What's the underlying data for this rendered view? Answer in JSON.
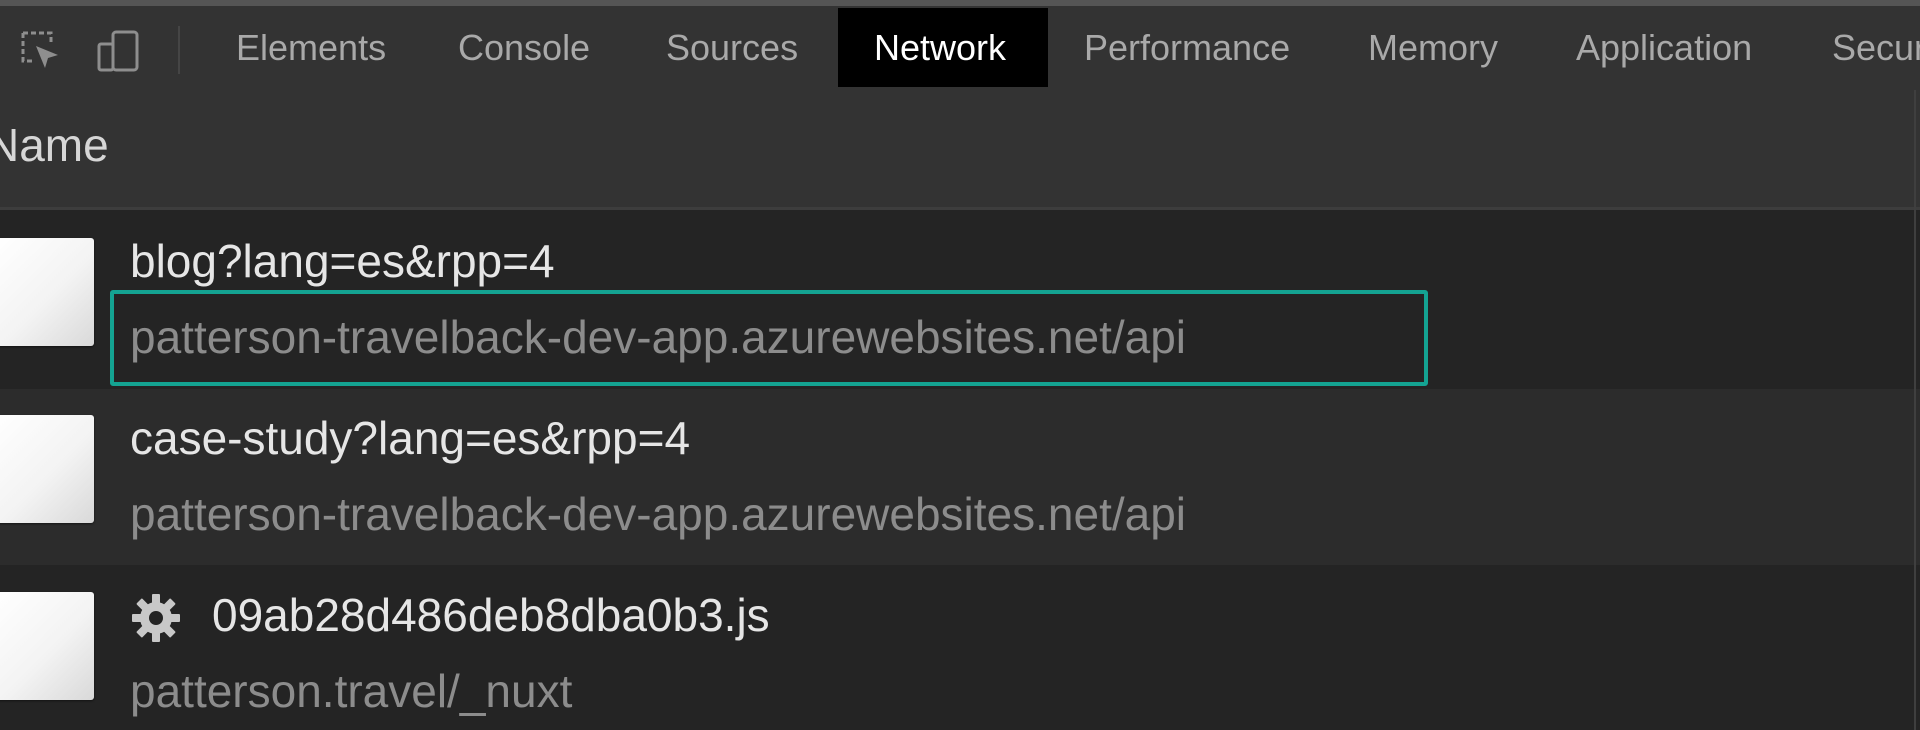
{
  "toolbar": {
    "icons": [
      "select-element-icon",
      "device-toolbar-icon"
    ],
    "tabs": [
      {
        "label": "Elements",
        "active": false
      },
      {
        "label": "Console",
        "active": false
      },
      {
        "label": "Sources",
        "active": false
      },
      {
        "label": "Network",
        "active": true
      },
      {
        "label": "Performance",
        "active": false
      },
      {
        "label": "Memory",
        "active": false
      },
      {
        "label": "Application",
        "active": false
      },
      {
        "label": "Security",
        "active": false
      }
    ]
  },
  "table": {
    "header": {
      "name_label": "Name"
    },
    "rows": [
      {
        "name": "blog?lang=es&rpp=4",
        "domain": "patterson-travelback-dev-app.azurewebsites.net/api",
        "icon": "file-icon",
        "highlighted": true
      },
      {
        "name": "case-study?lang=es&rpp=4",
        "domain": "patterson-travelback-dev-app.azurewebsites.net/api",
        "icon": "file-icon",
        "highlighted": false
      },
      {
        "name": "09ab28d486deb8dba0b3.js",
        "domain": "patterson.travel/_nuxt",
        "icon": "file-icon",
        "type_icon": "gear-icon",
        "highlighted": false
      }
    ]
  },
  "colors": {
    "active_tab_bg": "#000000",
    "highlight_border": "#14a392",
    "panel_bg": "#242424",
    "toolbar_bg": "#333333"
  }
}
